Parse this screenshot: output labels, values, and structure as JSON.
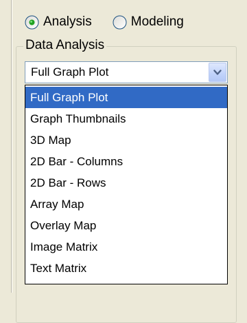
{
  "mode_radios": [
    {
      "label": "Analysis",
      "selected": true
    },
    {
      "label": "Modeling",
      "selected": false
    }
  ],
  "data_analysis": {
    "group_label": "Data Analysis",
    "selected_value": "Full Graph Plot",
    "dropdown_icon": "chevron-down-icon",
    "options": [
      {
        "label": "Full Graph Plot",
        "highlighted": true
      },
      {
        "label": "Graph Thumbnails",
        "highlighted": false
      },
      {
        "label": "3D Map",
        "highlighted": false
      },
      {
        "label": "2D Bar - Columns",
        "highlighted": false
      },
      {
        "label": "2D Bar - Rows",
        "highlighted": false
      },
      {
        "label": "Array Map",
        "highlighted": false
      },
      {
        "label": "Overlay Map",
        "highlighted": false
      },
      {
        "label": "Image Matrix",
        "highlighted": false
      },
      {
        "label": "Text Matrix",
        "highlighted": false
      }
    ]
  },
  "colors": {
    "window_background": "#ece9d8",
    "selection_highlight": "#316ac5",
    "radio_dot": "#21a121",
    "combo_border": "#7f9db9"
  }
}
